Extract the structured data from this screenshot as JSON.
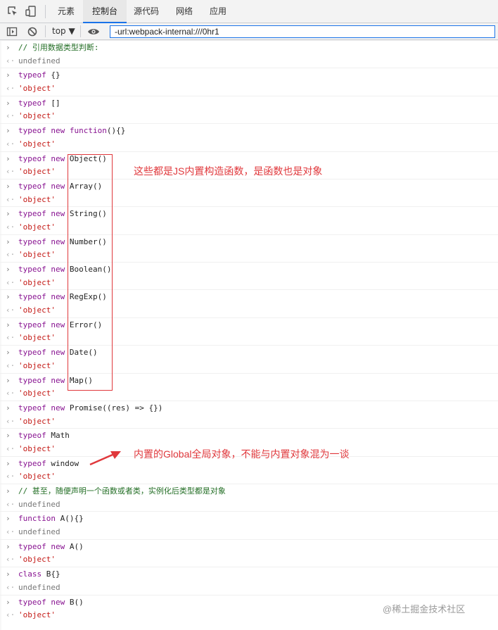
{
  "tabs": [
    "元素",
    "控制台",
    "源代码",
    "网络",
    "应用"
  ],
  "active_tab": "控制台",
  "toolbar": {
    "context": "top ▼",
    "filter_value": "-url:webpack-internal:///0hr1"
  },
  "icons": {
    "inspect": "inspect-icon",
    "device": "device-toggle-icon",
    "sidebar": "sidebar-toggle-icon",
    "clear": "clear-console-icon",
    "eye": "live-expression-icon",
    "prompt": "chevron-right-icon",
    "return": "return-arrow-icon"
  },
  "colors": {
    "annotation": "#e0383c",
    "keyword": "#881391",
    "string": "#c41a16",
    "comment": "#236e25"
  },
  "lines": [
    {
      "kind": "in",
      "t": "// 引用数据类型判断:"
    },
    {
      "kind": "out",
      "t": "undefined"
    },
    {
      "kind": "in",
      "t": "typeof {}"
    },
    {
      "kind": "out",
      "t": "'object'"
    },
    {
      "kind": "in",
      "t": "typeof []"
    },
    {
      "kind": "out",
      "t": "'object'"
    },
    {
      "kind": "in",
      "t": "typeof new function(){}"
    },
    {
      "kind": "out",
      "t": "'object'"
    },
    {
      "kind": "in",
      "t": "typeof new Object()"
    },
    {
      "kind": "out",
      "t": "'object'"
    },
    {
      "kind": "in",
      "t": "typeof new Array()"
    },
    {
      "kind": "out",
      "t": "'object'"
    },
    {
      "kind": "in",
      "t": "typeof new String()"
    },
    {
      "kind": "out",
      "t": "'object'"
    },
    {
      "kind": "in",
      "t": "typeof new Number()"
    },
    {
      "kind": "out",
      "t": "'object'"
    },
    {
      "kind": "in",
      "t": "typeof new Boolean()"
    },
    {
      "kind": "out",
      "t": "'object'"
    },
    {
      "kind": "in",
      "t": "typeof new RegExp()"
    },
    {
      "kind": "out",
      "t": "'object'"
    },
    {
      "kind": "in",
      "t": "typeof new Error()"
    },
    {
      "kind": "out",
      "t": "'object'"
    },
    {
      "kind": "in",
      "t": "typeof new Date()"
    },
    {
      "kind": "out",
      "t": "'object'"
    },
    {
      "kind": "in",
      "t": "typeof new Map()"
    },
    {
      "kind": "out",
      "t": "'object'"
    },
    {
      "kind": "in",
      "t": "typeof new Promise((res) => {})"
    },
    {
      "kind": "out",
      "t": "'object'"
    },
    {
      "kind": "in",
      "t": "typeof Math"
    },
    {
      "kind": "out",
      "t": "'object'"
    },
    {
      "kind": "in",
      "t": "typeof window"
    },
    {
      "kind": "out",
      "t": "'object'"
    },
    {
      "kind": "in",
      "t": "// 甚至，随便声明一个函数或者类，实例化后类型都是对象"
    },
    {
      "kind": "out",
      "t": "undefined"
    },
    {
      "kind": "in",
      "t": "function A(){}"
    },
    {
      "kind": "out",
      "t": "undefined"
    },
    {
      "kind": "in",
      "t": "typeof new A()"
    },
    {
      "kind": "out",
      "t": "'object'"
    },
    {
      "kind": "in",
      "t": "class B{}"
    },
    {
      "kind": "out",
      "t": "undefined"
    },
    {
      "kind": "in",
      "t": "typeof new B()"
    },
    {
      "kind": "out",
      "t": "'object'"
    }
  ],
  "annotations": {
    "constructors": "这些都是JS内置构造函数，是函数也是对象",
    "global": "内置的Global全局对象，不能与内置对象混为一谈"
  },
  "watermark": "@稀土掘金技术社区"
}
